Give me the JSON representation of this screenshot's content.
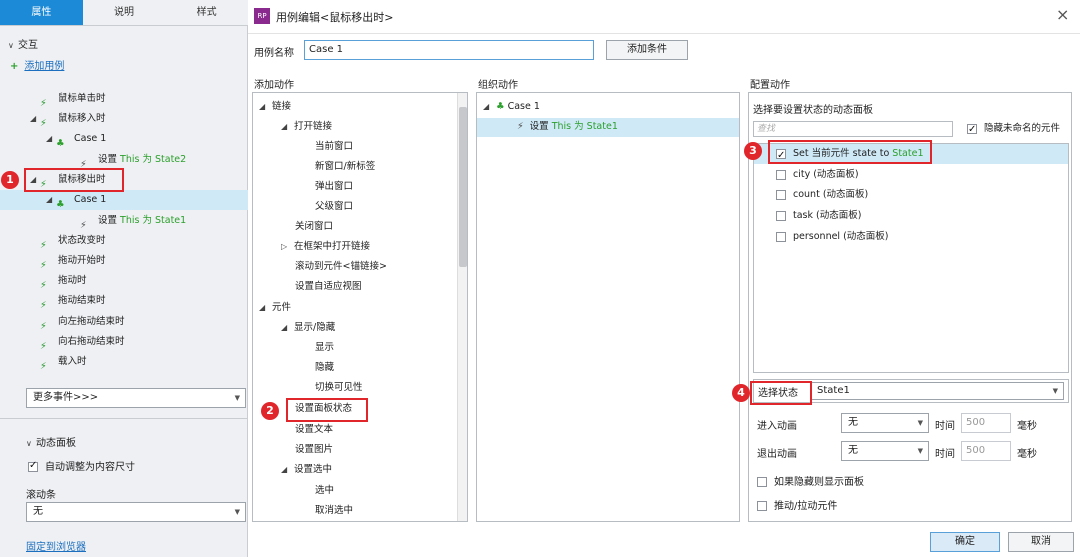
{
  "left": {
    "tabs": [
      "属性",
      "说明",
      "样式"
    ],
    "section_title": "交互",
    "add_case": "添加用例",
    "events": [
      {
        "label": "鼠标单击时"
      },
      {
        "label": "鼠标移入时"
      },
      {
        "label": "Case 1"
      },
      {
        "action_prefix": "设置",
        "action_highlight": "This 为 State2"
      },
      {
        "label": "鼠标移出时"
      },
      {
        "label": "Case 1"
      },
      {
        "action_prefix": "设置",
        "action_highlight": "This 为 State1"
      },
      {
        "label": "状态改变时"
      },
      {
        "label": "拖动开始时"
      },
      {
        "label": "拖动时"
      },
      {
        "label": "拖动结束时"
      },
      {
        "label": "向左拖动结束时"
      },
      {
        "label": "向右拖动结束时"
      },
      {
        "label": "载入时"
      }
    ],
    "more_events": "更多事件>>>",
    "dynamic_panel_title": "动态面板",
    "auto_fit_label": "自动调整为内容尺寸",
    "scrollbar_label": "滚动条",
    "scrollbar_value": "无",
    "pin_browser": "固定到浏览器"
  },
  "dialog": {
    "title": "用例编辑<鼠标移出时>",
    "close": "×",
    "case_name_label": "用例名称",
    "case_name_value": "Case 1",
    "add_condition": "添加条件",
    "add_action_title": "添加动作",
    "org_action_title": "组织动作",
    "config_action_title": "配置动作",
    "add_actions": [
      {
        "text": "链接"
      },
      {
        "text": "打开链接"
      },
      {
        "text": "当前窗口"
      },
      {
        "text": "新窗口/新标签"
      },
      {
        "text": "弹出窗口"
      },
      {
        "text": "父级窗口"
      },
      {
        "text": "关闭窗口"
      },
      {
        "text": "在框架中打开链接"
      },
      {
        "text": "滚动到元件<锚链接>"
      },
      {
        "text": "设置自适应视图"
      },
      {
        "text": "元件"
      },
      {
        "text": "显示/隐藏"
      },
      {
        "text": "显示"
      },
      {
        "text": "隐藏"
      },
      {
        "text": "切换可见性"
      },
      {
        "text": "设置面板状态"
      },
      {
        "text": "设置文本"
      },
      {
        "text": "设置图片"
      },
      {
        "text": "设置选中"
      },
      {
        "text": "选中"
      },
      {
        "text": "取消选中"
      }
    ],
    "org_case": "Case 1",
    "org_action_prefix": "设置",
    "org_action_highlight": "This 为 State1",
    "select_panel_label": "选择要设置状态的动态面板",
    "search_placeholder": "查找",
    "hide_unnamed_label": "隐藏未命名的元件",
    "panels": [
      {
        "prefix": "Set 当前元件 state to ",
        "highlight": "State1"
      },
      {
        "text": "city (动态面板)"
      },
      {
        "text": "count (动态面板)"
      },
      {
        "text": "task (动态面板)"
      },
      {
        "text": "personnel (动态面板)"
      }
    ],
    "select_state_label": "选择状态",
    "select_state_value": "State1",
    "enter_anim_label": "进入动画",
    "exit_anim_label": "退出动画",
    "anim_value": "无",
    "time_label": "时间",
    "time_value": "500",
    "ms_label": "毫秒",
    "show_if_hidden": "如果隐藏则显示面板",
    "push_pull": "推动/拉动元件",
    "ok": "确定",
    "cancel": "取消"
  },
  "markers": [
    "1",
    "2",
    "3",
    "4"
  ],
  "colors": {
    "accent": "#1c8ad6",
    "highlight_green": "#2ca02c",
    "marker_red": "#e0262b",
    "selected_row": "#cfe9f7"
  }
}
